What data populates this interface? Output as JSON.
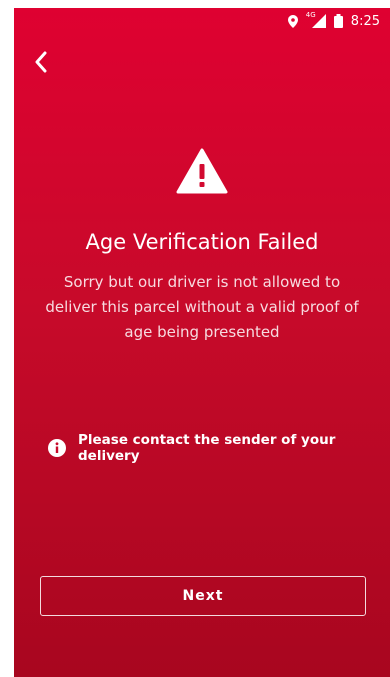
{
  "status_bar": {
    "time": "8:25",
    "network": "4G",
    "icons": [
      "location-icon",
      "signal-icon",
      "battery-icon"
    ]
  },
  "header": {
    "back_icon": "chevron-left-icon"
  },
  "main": {
    "warning_icon": "warning-triangle-icon",
    "title": "Age Verification Failed",
    "message": "Sorry but our driver is not allowed to deliver this parcel without a valid proof of age being presented",
    "notice_icon": "info-icon",
    "notice": "Please contact the sender of your delivery"
  },
  "footer": {
    "next_label": "Next"
  },
  "colors": {
    "background_top": "#df0131",
    "background_bottom": "#a8061f",
    "text": "#ffffff"
  }
}
